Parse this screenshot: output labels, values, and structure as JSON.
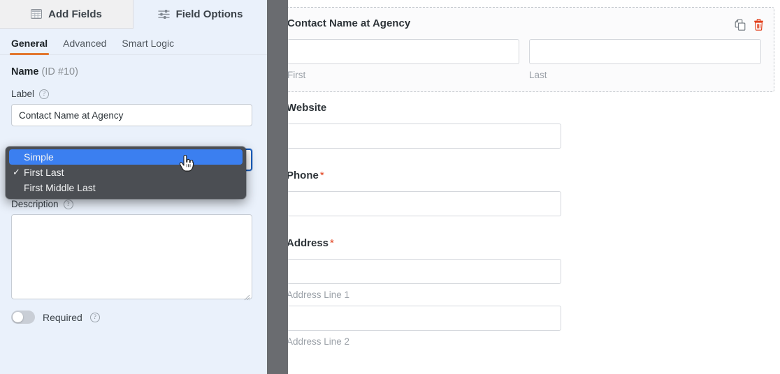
{
  "tabs": {
    "add_fields": {
      "label": "Add Fields",
      "icon": "table-grid-icon"
    },
    "field_options": {
      "label": "Field Options",
      "icon": "sliders-icon"
    }
  },
  "subtabs": [
    {
      "label": "General",
      "active": true
    },
    {
      "label": "Advanced",
      "active": false
    },
    {
      "label": "Smart Logic",
      "active": false
    }
  ],
  "field_header": {
    "name": "Name",
    "id_text": "(ID #10)"
  },
  "options": {
    "label_label": "Label",
    "label_value": "Contact Name at Agency",
    "description_label": "Description",
    "description_value": "",
    "required_label": "Required",
    "help_glyph": "?"
  },
  "dropdown": {
    "open": true,
    "items": [
      {
        "label": "Simple",
        "checked": false,
        "highlighted": true
      },
      {
        "label": "First Last",
        "checked": true,
        "highlighted": false
      },
      {
        "label": "First Middle Last",
        "checked": false,
        "highlighted": false
      }
    ],
    "check_glyph": "✓",
    "highlight_color": "#3b7ff0",
    "background_color": "#4b4e53"
  },
  "cursor": {
    "type": "pointing-hand-cursor"
  },
  "preview": {
    "accent_required_color": "#e2401c",
    "fields": [
      {
        "label": "Contact Name at Agency",
        "required": false,
        "selected": true,
        "layout": "two-column",
        "columns": [
          {
            "sublabel": "First"
          },
          {
            "sublabel": "Last"
          }
        ],
        "actions": [
          {
            "name": "duplicate-field-icon",
            "title": "Duplicate"
          },
          {
            "name": "delete-field-icon",
            "title": "Delete"
          }
        ]
      },
      {
        "label": "Website",
        "required": false,
        "selected": false,
        "layout": "single",
        "columns": [
          {
            "sublabel": ""
          }
        ]
      },
      {
        "label": "Phone",
        "required": true,
        "selected": false,
        "layout": "single",
        "columns": [
          {
            "sublabel": ""
          }
        ]
      },
      {
        "label": "Address",
        "required": true,
        "selected": false,
        "layout": "stacked",
        "columns": [
          {
            "sublabel": "Address Line 1"
          },
          {
            "sublabel": "Address Line 2"
          }
        ]
      }
    ],
    "required_marker": "*"
  }
}
